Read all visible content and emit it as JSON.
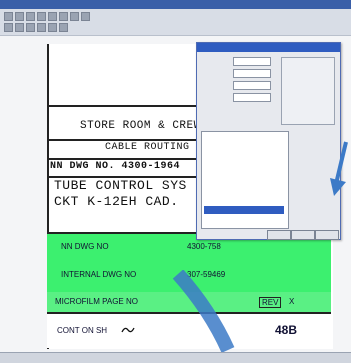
{
  "window": {
    "title": ""
  },
  "drawing": {
    "line1": "STORE ROOM & CREWS",
    "line2": "CABLE ROUTING",
    "dwg_line": "NN DWG NO. 4300-1964",
    "line4": "TUBE CONTROL SYS",
    "line5": "CKT K-12EH CAD."
  },
  "block": {
    "nn_dwg_label": "NN DWG NO",
    "nn_dwg_value": "4300-758",
    "internal_label": "INTERNAL DWG NO",
    "internal_value": "307-59469",
    "microfilm_label": "MICROFILM PAGE NO",
    "rev_label": "REV",
    "rev_value": "X",
    "cont_label": "CONT ON SH",
    "sheet_value": "48B"
  },
  "dialog": {
    "list_items": [
      "",
      "",
      "",
      "",
      "",
      "",
      "",
      "",
      "",
      ""
    ],
    "buttons": [
      "",
      "",
      "",
      ""
    ]
  },
  "colors": {
    "green": "#3cf06f",
    "dialog_blue": "#2f5cc0",
    "arrow": "#3c7ac7"
  }
}
